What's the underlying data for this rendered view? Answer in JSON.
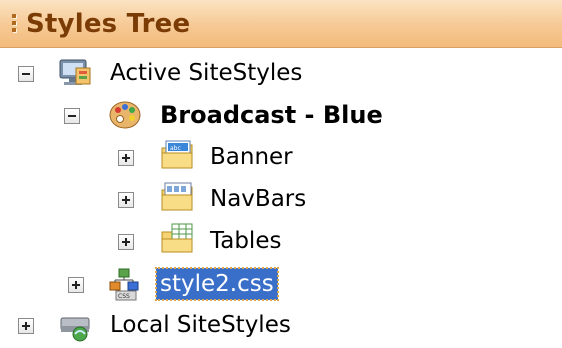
{
  "header": {
    "title": "Styles Tree"
  },
  "tree": {
    "active_sitestyles": {
      "label": "Active SiteStyles",
      "state": "expanded"
    },
    "broadcast_blue": {
      "label": "Broadcast - Blue",
      "state": "expanded"
    },
    "banner": {
      "label": "Banner",
      "state": "collapsed"
    },
    "navbars": {
      "label": "NavBars",
      "state": "collapsed"
    },
    "tables": {
      "label": "Tables",
      "state": "collapsed"
    },
    "style2_css": {
      "label": "style2.css",
      "state": "collapsed",
      "selected": true
    },
    "local_sitestyles": {
      "label": "Local SiteStyles",
      "state": "collapsed"
    }
  },
  "colors": {
    "header_bg": "#f6c994",
    "header_text": "#7a3b05",
    "selection_bg": "#3a6fc9"
  }
}
